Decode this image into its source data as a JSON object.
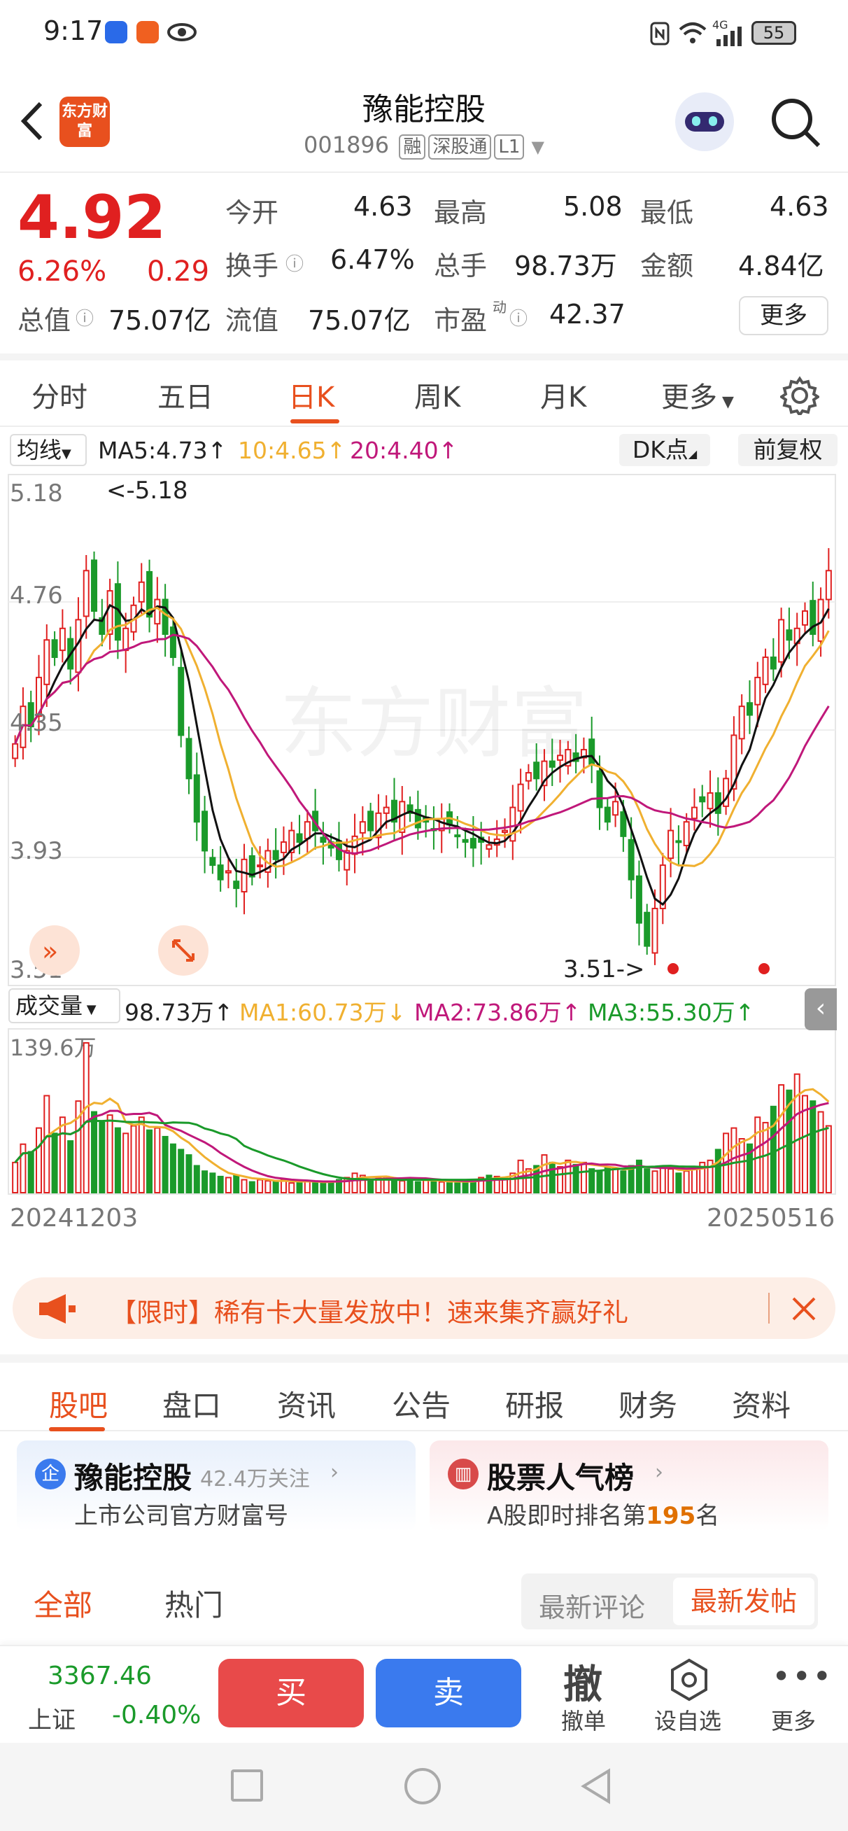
{
  "status": {
    "time": "9:17",
    "network": "4G",
    "battery": "55"
  },
  "header": {
    "title": "豫能控股",
    "code": "001896",
    "tags": [
      "融",
      "深股通",
      "L1"
    ],
    "logo_text": "东方财富"
  },
  "quote": {
    "price": "4.92",
    "change_pct": "6.26%",
    "change": "0.29",
    "open_label": "今开",
    "open": "4.63",
    "high_label": "最高",
    "high": "5.08",
    "low_label": "最低",
    "low": "4.63",
    "turnover_label": "换手",
    "turnover": "6.47%",
    "volume_label": "总手",
    "volume": "98.73万",
    "amount_label": "金额",
    "amount": "4.84亿",
    "mktcap_label": "总值",
    "mktcap": "75.07亿",
    "float_label": "流值",
    "float": "75.07亿",
    "pe_label": "市盈",
    "pe_sup": "动",
    "pe": "42.37",
    "more": "更多"
  },
  "tabs": [
    "分时",
    "五日",
    "日K",
    "周K",
    "月K",
    "更多"
  ],
  "indicator_bar": {
    "select": "均线",
    "ma5": "MA5:4.73↑",
    "ma10": "10:4.65↑",
    "ma20": "20:4.40↑",
    "dk": "DK点",
    "fq": "前复权"
  },
  "colors": {
    "up": "#e02020",
    "down": "#1a9a2a",
    "ma5": "#111111",
    "ma10": "#f0b030",
    "ma20": "#c0187a",
    "accent": "#e8501e",
    "sell": "#3a7aee"
  },
  "chart_data": {
    "type": "candlestick",
    "price_axis": [
      "5.18",
      "4.76",
      "4.35",
      "3.93",
      "3.51"
    ],
    "ylim": [
      3.51,
      5.18
    ],
    "max_label": "<-5.18",
    "min_label": "3.51->",
    "watermark": "东方财富",
    "start_date": "20241203",
    "end_date": "20250516",
    "close": [
      4.32,
      4.45,
      4.38,
      4.55,
      4.68,
      4.62,
      4.72,
      4.58,
      4.75,
      4.92,
      4.78,
      4.7,
      4.85,
      4.68,
      4.72,
      4.8,
      4.88,
      4.76,
      4.82,
      4.7,
      4.62,
      4.35,
      4.2,
      4.05,
      3.95,
      3.9,
      3.85,
      3.88,
      3.82,
      3.92,
      3.86,
      3.9,
      3.95,
      3.92,
      3.98,
      4.02,
      3.98,
      4.05,
      4.02,
      3.98,
      3.96,
      3.92,
      3.95,
      4.0,
      4.05,
      4.02,
      4.08,
      4.1,
      4.05,
      4.12,
      4.08,
      4.03,
      4.05,
      4.02,
      4.06,
      4.04,
      4.0,
      3.98,
      3.96,
      3.98,
      3.97,
      3.99,
      4.02,
      4.1,
      4.18,
      4.22,
      4.2,
      4.26,
      4.24,
      4.28,
      4.3,
      4.26,
      4.3,
      4.25,
      4.1,
      4.05,
      4.12,
      4.0,
      3.85,
      3.7,
      3.62,
      3.75,
      3.9,
      4.02,
      3.98,
      4.05,
      4.1,
      4.12,
      4.15,
      4.08,
      4.2,
      4.35,
      4.45,
      4.42,
      4.55,
      4.62,
      4.58,
      4.75,
      4.68,
      4.72,
      4.78,
      4.7,
      4.82,
      4.92
    ],
    "volume_axis_max": "139.6万",
    "volume": [
      28,
      45,
      38,
      60,
      90,
      55,
      70,
      48,
      85,
      139,
      75,
      65,
      72,
      60,
      55,
      62,
      70,
      58,
      60,
      52,
      45,
      40,
      35,
      25,
      20,
      18,
      15,
      14,
      16,
      12,
      10,
      12,
      11,
      10,
      12,
      9,
      10,
      11,
      10,
      9,
      10,
      12,
      14,
      18,
      16,
      12,
      14,
      15,
      12,
      11,
      13,
      10,
      12,
      11,
      10,
      9,
      10,
      11,
      12,
      14,
      16,
      15,
      14,
      18,
      30,
      22,
      25,
      35,
      28,
      24,
      30,
      26,
      28,
      22,
      20,
      24,
      22,
      20,
      25,
      30,
      22,
      20,
      24,
      22,
      18,
      20,
      24,
      28,
      30,
      40,
      55,
      60,
      50,
      45,
      70,
      65,
      80,
      100,
      95,
      110,
      90,
      85,
      75,
      62
    ]
  },
  "volume_bar": {
    "select": "成交量",
    "vol": "98.73万↑",
    "ma1": "MA1:60.73万↓",
    "ma2": "MA2:73.86万↑",
    "ma3": "MA3:55.30万↑"
  },
  "banner": {
    "text": "【限时】稀有卡大量发放中！速来集齐赢好礼"
  },
  "bottom_tabs": [
    "股吧",
    "盘口",
    "资讯",
    "公告",
    "研报",
    "财务",
    "资料"
  ],
  "cards": {
    "left_title": "豫能控股",
    "left_follow": "42.4万关注",
    "left_sub": "上市公司官方财富号",
    "right_title": "股票人气榜",
    "right_sub_pre": "A股即时排名第",
    "right_rank": "195",
    "right_sub_post": "名"
  },
  "filter": {
    "all": "全部",
    "hot": "热门",
    "latest_comment": "最新评论",
    "latest_post": "最新发帖"
  },
  "footer": {
    "index_value": "3367.46",
    "index_name": "上证",
    "index_change": "-0.40%",
    "buy": "买",
    "sell": "卖",
    "cancel_icon": "撤",
    "cancel": "撤单",
    "watch": "设自选",
    "more": "更多"
  }
}
